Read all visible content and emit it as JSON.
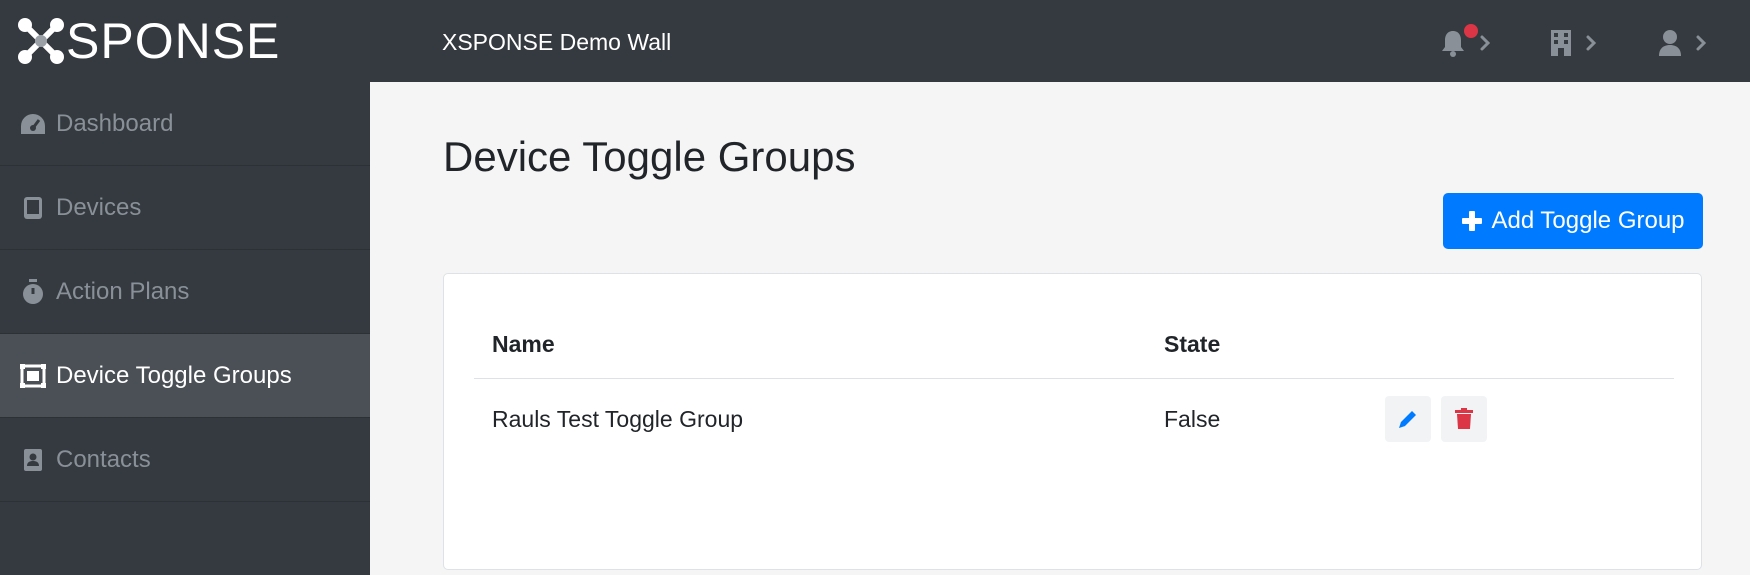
{
  "header": {
    "logo_text": "SPONSE",
    "app_title": "XSPONSE Demo Wall",
    "icons": [
      "bell-icon",
      "building-icon",
      "user-icon"
    ],
    "notification_color": "#dc3545"
  },
  "sidebar": {
    "items": [
      {
        "label": "Dashboard",
        "icon": "speedometer-icon"
      },
      {
        "label": "Devices",
        "icon": "tablet-icon"
      },
      {
        "label": "Action Plans",
        "icon": "stopwatch-icon"
      },
      {
        "label": "Device Toggle Groups",
        "icon": "object-group-icon",
        "active": true
      },
      {
        "label": "Contacts",
        "icon": "address-book-icon"
      }
    ]
  },
  "main": {
    "title": "Device Toggle Groups",
    "add_button": "Add Toggle Group",
    "table": {
      "headers": [
        "Name",
        "State"
      ],
      "rows": [
        {
          "name": "Rauls Test Toggle Group",
          "state": "False"
        }
      ]
    }
  },
  "colors": {
    "primary": "#007bff",
    "danger": "#dc3545",
    "dark": "#343a40"
  }
}
